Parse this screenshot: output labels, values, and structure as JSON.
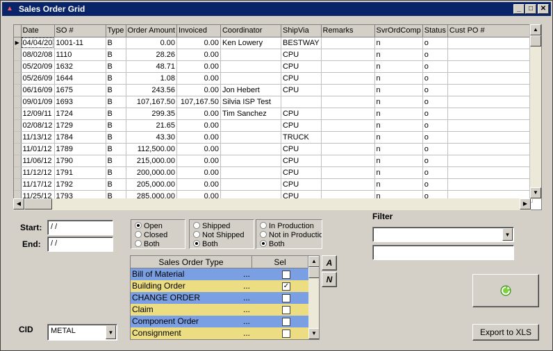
{
  "window": {
    "title": "Sales Order Grid"
  },
  "grid": {
    "columns": [
      "Date",
      "SO #",
      "Type",
      "Order Amount",
      "Invoiced",
      "Coordinator",
      "ShipVia",
      "Remarks",
      "SvrOrdComp",
      "Status",
      "Cust PO #"
    ],
    "rows": [
      [
        "04/04/20",
        "1001-11",
        "B",
        "0.00",
        "0.00",
        "Ken Lowery",
        "BESTWAY",
        "",
        "n",
        "o",
        ""
      ],
      [
        "08/02/08",
        "1110",
        "B",
        "28.26",
        "0.00",
        "",
        "CPU",
        "",
        "n",
        "o",
        ""
      ],
      [
        "05/20/09",
        "1632",
        "B",
        "48.71",
        "0.00",
        "",
        "CPU",
        "",
        "n",
        "o",
        ""
      ],
      [
        "05/26/09",
        "1644",
        "B",
        "1.08",
        "0.00",
        "",
        "CPU",
        "",
        "n",
        "o",
        ""
      ],
      [
        "06/16/09",
        "1675",
        "B",
        "243.56",
        "0.00",
        "Jon Hebert",
        "CPU",
        "",
        "n",
        "o",
        ""
      ],
      [
        "09/01/09",
        "1693",
        "B",
        "107,167.50",
        "107,167.50",
        "Silvia ISP Test",
        "",
        "",
        "n",
        "o",
        ""
      ],
      [
        "12/09/11",
        "1724",
        "B",
        "299.35",
        "0.00",
        "Tim Sanchez",
        "CPU",
        "",
        "n",
        "o",
        ""
      ],
      [
        "02/08/12",
        "1729",
        "B",
        "21.65",
        "0.00",
        "",
        "CPU",
        "",
        "n",
        "o",
        ""
      ],
      [
        "11/13/12",
        "1784",
        "B",
        "43.30",
        "0.00",
        "",
        "TRUCK",
        "",
        "n",
        "o",
        ""
      ],
      [
        "11/01/12",
        "1789",
        "B",
        "112,500.00",
        "0.00",
        "",
        "CPU",
        "",
        "n",
        "o",
        ""
      ],
      [
        "11/06/12",
        "1790",
        "B",
        "215,000.00",
        "0.00",
        "",
        "CPU",
        "",
        "n",
        "o",
        ""
      ],
      [
        "11/12/12",
        "1791",
        "B",
        "200,000.00",
        "0.00",
        "",
        "CPU",
        "",
        "n",
        "o",
        ""
      ],
      [
        "11/17/12",
        "1792",
        "B",
        "205,000.00",
        "0.00",
        "",
        "CPU",
        "",
        "n",
        "o",
        ""
      ],
      [
        "11/25/12",
        "1793",
        "B",
        "285,000.00",
        "0.00",
        "",
        "CPU",
        "",
        "n",
        "o",
        ""
      ]
    ]
  },
  "dates": {
    "start_label": "Start:",
    "end_label": "End:",
    "start_value": " / /",
    "end_value": " / /"
  },
  "status_group": {
    "options": [
      "Open",
      "Closed",
      "Both"
    ],
    "selected": 0
  },
  "ship_group": {
    "options": [
      "Shipped",
      "Not Shipped",
      "Both"
    ],
    "selected": 2
  },
  "prod_group": {
    "options": [
      "In Production",
      "Not in Production",
      "Both"
    ],
    "selected": 2
  },
  "order_types": {
    "header_type": "Sales Order Type",
    "header_sel": "Sel",
    "items": [
      {
        "name": "Bill of Material",
        "dots": "...",
        "checked": false
      },
      {
        "name": "Building Order",
        "dots": "...",
        "checked": true
      },
      {
        "name": "CHANGE ORDER",
        "dots": "...",
        "checked": false
      },
      {
        "name": "Claim",
        "dots": "...",
        "checked": false
      },
      {
        "name": "Component Order",
        "dots": "...",
        "checked": false
      },
      {
        "name": "Consignment",
        "dots": "...",
        "checked": false
      }
    ]
  },
  "side_buttons": {
    "all": "A",
    "none": "N"
  },
  "filter": {
    "label": "Filter",
    "select_value": "",
    "text_value": ""
  },
  "cid": {
    "label": "CID",
    "value": "METAL"
  },
  "export_button": "Export to XLS",
  "refresh_icon": "refresh-icon",
  "check_mark": "✓"
}
